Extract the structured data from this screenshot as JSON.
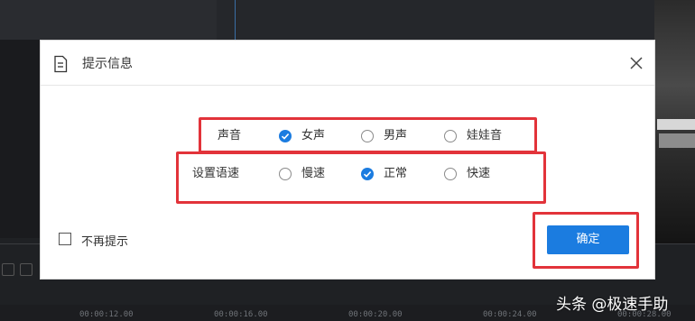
{
  "dialog": {
    "title": "提示信息",
    "voice_row": {
      "label": "声音",
      "options": [
        {
          "label": "女声",
          "checked": true
        },
        {
          "label": "男声",
          "checked": false
        },
        {
          "label": "娃娃音",
          "checked": false
        }
      ]
    },
    "speed_row": {
      "label": "设置语速",
      "options": [
        {
          "label": "慢速",
          "checked": false
        },
        {
          "label": "正常",
          "checked": true
        },
        {
          "label": "快速",
          "checked": false
        }
      ]
    },
    "dont_remind_label": "不再提示",
    "dont_remind_checked": false,
    "confirm_label": "确定"
  },
  "timeline": {
    "ticks": [
      "00:00:12.00",
      "00:00:16.00",
      "00:00:20.00",
      "00:00:24.00",
      "00:00:28.00"
    ]
  },
  "watermark": "头条 @极速手助",
  "colors": {
    "accent": "#1b7ce0",
    "highlight": "#e2333a"
  }
}
